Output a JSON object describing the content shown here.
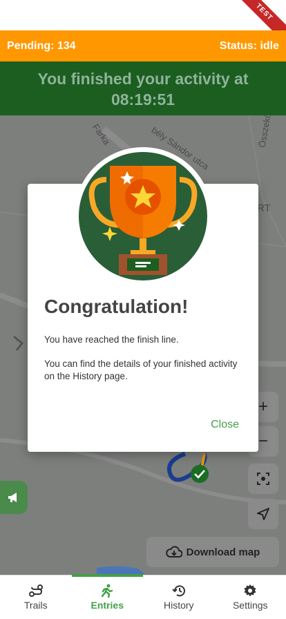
{
  "ribbon": {
    "label": "TEST"
  },
  "status_bar": {
    "pending": "Pending: 134",
    "status": "Status: idle"
  },
  "banner": {
    "line1": "You finished your activity at",
    "line2": "08:19:51"
  },
  "map": {
    "streets": [
      "Farka",
      "bély Sándor utca",
      "Összekö",
      "RT"
    ],
    "zoom_in": "+",
    "zoom_out": "−",
    "download_label": "Download map"
  },
  "modal": {
    "title": "Congratulation!",
    "text1": "You have reached the finish line.",
    "text2": "You can find the details of your finished activity on the History page.",
    "close": "Close"
  },
  "nav": {
    "items": [
      {
        "label": "Trails",
        "icon": "route-icon"
      },
      {
        "label": "Entries",
        "icon": "running-icon"
      },
      {
        "label": "History",
        "icon": "history-icon"
      },
      {
        "label": "Settings",
        "icon": "gear-icon"
      }
    ],
    "active": "Entries"
  },
  "colors": {
    "orange": "#ff9800",
    "dark_green": "#1b5e20",
    "accent_green": "#43a047"
  }
}
